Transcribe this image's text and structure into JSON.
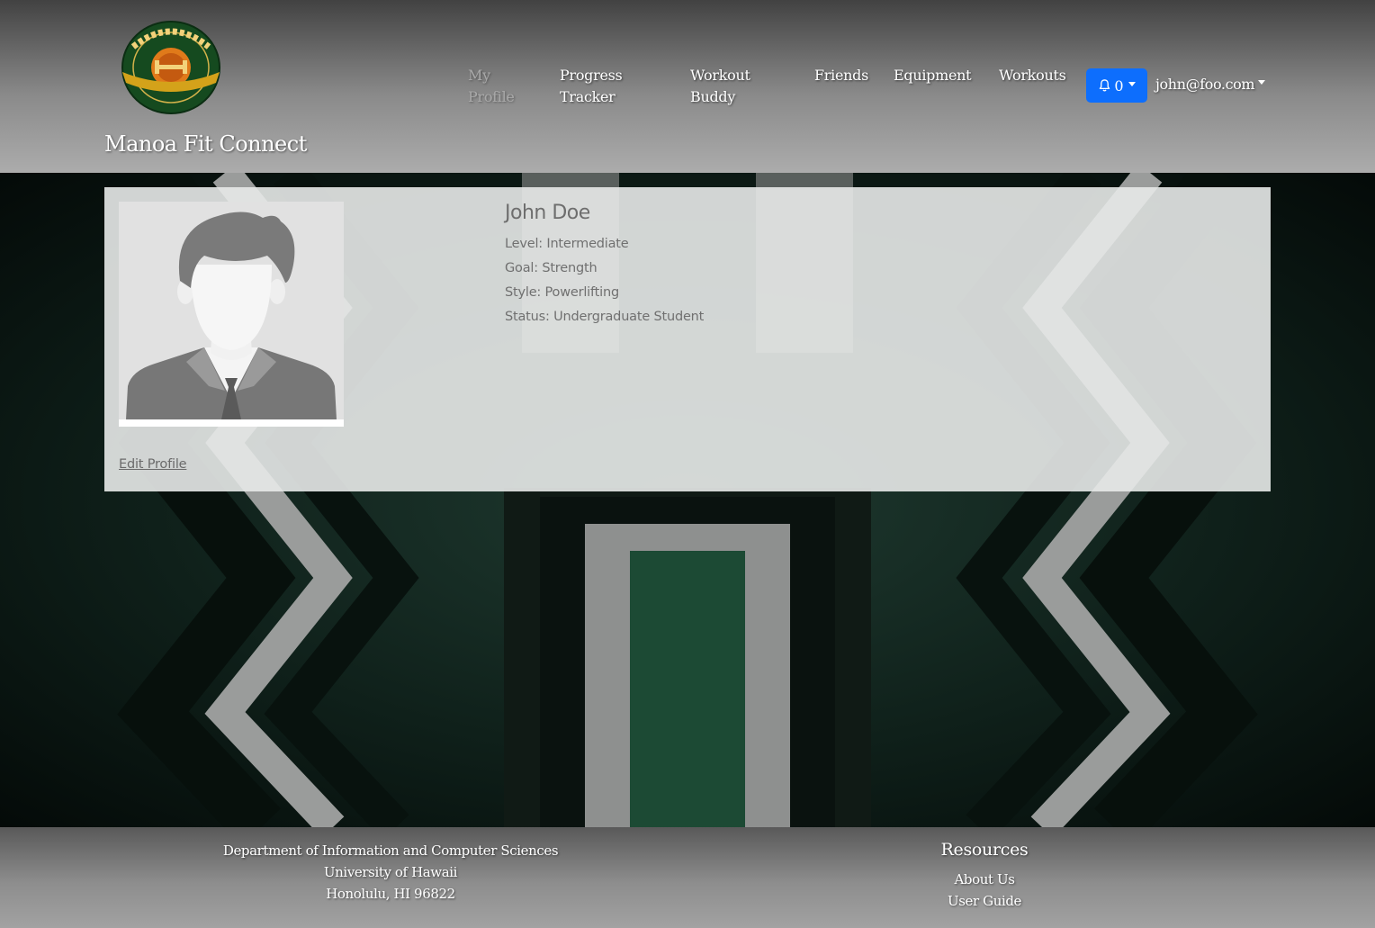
{
  "brand": {
    "name": "Manoa Fit Connect",
    "logo_icon": "manoa-fit-connect-logo"
  },
  "nav": {
    "items": [
      {
        "label_line1": "My",
        "label_line2": "Profile",
        "active": true
      },
      {
        "label_line1": "Progress",
        "label_line2": "Tracker",
        "active": false
      },
      {
        "label_line1": "Workout",
        "label_line2": "Buddy",
        "active": false
      },
      {
        "label_line1": "Friends",
        "label_line2": "",
        "active": false
      },
      {
        "label_line1": "Equipment",
        "label_line2": "",
        "active": false
      },
      {
        "label_line1": "Workouts",
        "label_line2": "",
        "active": false
      }
    ],
    "notifications": {
      "icon": "bell-icon",
      "count": "0"
    },
    "user_email": "john@foo.com"
  },
  "profile": {
    "avatar_icon": "default-avatar",
    "name": "John Doe",
    "level": "Level: Intermediate",
    "goal": "Goal: Strength",
    "style": "Style: Powerlifting",
    "status": "Status: Undergraduate Student",
    "edit_label": "Edit Profile"
  },
  "footer": {
    "address": [
      "Department of Information and Computer Sciences",
      "University of Hawaii",
      "Honolulu, HI 96822"
    ],
    "resources_title": "Resources",
    "resources_links": [
      "About Us",
      "User Guide"
    ]
  },
  "colors": {
    "notification_button": "#0d6efd",
    "background_green": "#1f3a30"
  }
}
